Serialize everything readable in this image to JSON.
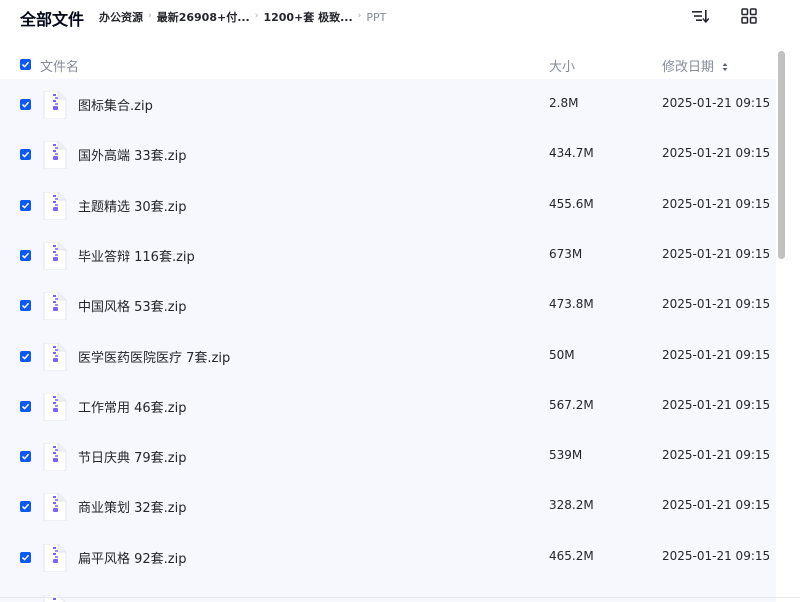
{
  "header": {
    "title": "全部文件",
    "breadcrumbs": [
      "办公资源",
      "最新26908+付...",
      "1200+套 极致...",
      "PPT"
    ],
    "sort_icon": "sort-list-icon",
    "grid_icon": "grid-view-icon"
  },
  "columns": {
    "name": "文件名",
    "size": "大小",
    "date": "修改日期"
  },
  "colors": {
    "accent": "#0a59f7",
    "row_bg": "#f6f8fe",
    "icon_tint": "#7b61ff"
  },
  "files": [
    {
      "name": "图标集合.zip",
      "size": "2.8M",
      "date": "2025-01-21 09:15",
      "checked": true
    },
    {
      "name": "国外高端 33套.zip",
      "size": "434.7M",
      "date": "2025-01-21 09:15",
      "checked": true
    },
    {
      "name": "主题精选 30套.zip",
      "size": "455.6M",
      "date": "2025-01-21 09:15",
      "checked": true
    },
    {
      "name": "毕业答辩 116套.zip",
      "size": "673M",
      "date": "2025-01-21 09:15",
      "checked": true
    },
    {
      "name": "中国风格 53套.zip",
      "size": "473.8M",
      "date": "2025-01-21 09:15",
      "checked": true
    },
    {
      "name": "医学医药医院医疗 7套.zip",
      "size": "50M",
      "date": "2025-01-21 09:15",
      "checked": true
    },
    {
      "name": "工作常用 46套.zip",
      "size": "567.2M",
      "date": "2025-01-21 09:15",
      "checked": true
    },
    {
      "name": "节日庆典 79套.zip",
      "size": "539M",
      "date": "2025-01-21 09:15",
      "checked": true
    },
    {
      "name": "商业策划 32套.zip",
      "size": "328.2M",
      "date": "2025-01-21 09:15",
      "checked": true
    },
    {
      "name": "扁平风格 92套.zip",
      "size": "465.2M",
      "date": "2025-01-21 09:15",
      "checked": true
    }
  ]
}
